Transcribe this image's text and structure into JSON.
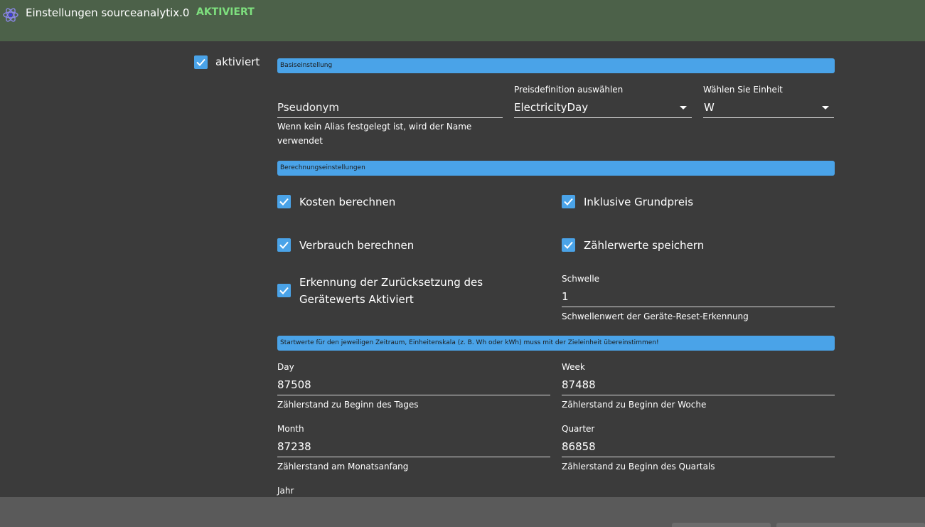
{
  "header": {
    "title": "Einstellungen sourceanalytix.0",
    "status": "AKTIVIERT",
    "logo_icon": "atom-icon",
    "status_color": "#7ee07e",
    "bar_color": "#4c6149"
  },
  "enabled": {
    "label": "aktiviert",
    "checked": true
  },
  "basic": {
    "section_title": "Basiseinstellung",
    "alias": {
      "placeholder": "Pseudonym",
      "help": "Wenn kein Alias festgelegt ist, wird der Name verwendet"
    },
    "price_def": {
      "label": "Preisdefinition auswählen",
      "value": "ElectricityDay"
    },
    "unit": {
      "label": "Wählen Sie Einheit",
      "value": "W"
    }
  },
  "calc": {
    "section_title": "Berechnungseinstellungen",
    "costs": {
      "label": "Kosten berechnen",
      "checked": true
    },
    "base_price": {
      "label": "Inklusive Grundpreis",
      "checked": true
    },
    "consumption": {
      "label": "Verbrauch berechnen",
      "checked": true
    },
    "meter_values": {
      "label": "Zählerwerte speichern",
      "checked": true
    },
    "reset_detection": {
      "label_line1": "Erkennung der Zurücksetzung des",
      "label_line2": "Gerätewerts Aktiviert",
      "checked": true
    },
    "threshold": {
      "label": "Schwelle",
      "value": "1",
      "help": "Schwellenwert der Geräte-Reset-Erkennung"
    }
  },
  "start_values": {
    "section_title": "Startwerte für den jeweiligen Zeitraum, Einheitenskala (z. B. Wh oder kWh) muss mit der Zieleinheit übereinstimmen!",
    "day": {
      "label": "Day",
      "value": "87508",
      "help": "Zählerstand zu Beginn des Tages"
    },
    "week": {
      "label": "Week",
      "value": "87488",
      "help": "Zählerstand zu Beginn der Woche"
    },
    "month": {
      "label": "Month",
      "value": "87238",
      "help": "Zählerstand am Monatsanfang"
    },
    "quarter": {
      "label": "Quarter",
      "value": "86858",
      "help": "Zählerstand zu Beginn des Quartals"
    },
    "year": {
      "label": "Jahr"
    }
  },
  "colors": {
    "accent": "#4aa3e8",
    "background": "#3b3b3b",
    "footer": "#5a5a5a"
  }
}
